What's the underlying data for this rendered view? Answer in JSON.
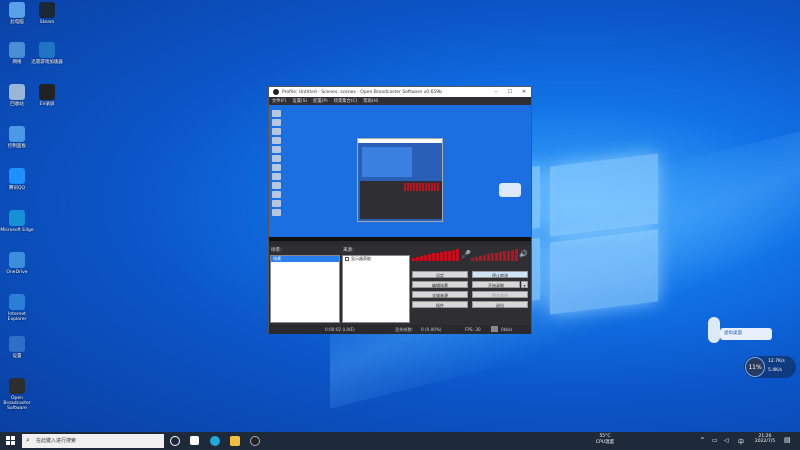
{
  "desktop_icons": [
    {
      "label": "此电脑",
      "color": "#5aa0e8"
    },
    {
      "label": "Steam",
      "color": "#1b2838"
    },
    {
      "label": "网络",
      "color": "#4a8fd6"
    },
    {
      "label": "迅雷游戏加速器",
      "color": "#1f74c4"
    },
    {
      "label": "回收站",
      "color": "#9ab6d6"
    },
    {
      "label": "EV录屏",
      "color": "#222222"
    },
    {
      "label": "控制面板",
      "color": "#4a9ae8"
    },
    {
      "label": "腾讯QQ",
      "color": "#1e90ff"
    },
    {
      "label": "Microsoft Edge",
      "color": "#1790d6"
    },
    {
      "label": "OneDrive",
      "color": "#3a8edc"
    },
    {
      "label": "Internet Explorer",
      "color": "#2a7fd6"
    },
    {
      "label": "设置",
      "color": "#2f6fc8"
    },
    {
      "label": "Open Broadcaster Software",
      "color": "#2e2e2e"
    }
  ],
  "obs": {
    "title": "Profile: Untitled - Scenes: scenes - Open Broadcaster Software v0.659b",
    "menu": [
      "文件(F)",
      "设置(S)",
      "配置(P)",
      "场景集合(C)",
      "帮助(H)"
    ],
    "scenes_label": "场景：",
    "sources_label": "来源：",
    "scene_item": "场景",
    "source_item": "显示器获取",
    "buttons": {
      "settings": "设定",
      "stop_stream": "停止串流",
      "edit_scene": "编辑场景",
      "start_record": "开始录制",
      "global_sources": "全域来源",
      "preview_stream": "预览串流",
      "plugins": "插件",
      "exit": "退出"
    },
    "status": {
      "time": "0:00:02 (LIVE)",
      "dropped": "丢失帧数:",
      "dropped_val": "0 (0.00%)",
      "fps": "FPS: 30",
      "kbps": "0kb/s"
    }
  },
  "taskbar": {
    "search_placeholder": "在此键入进行搜索",
    "weather_temp": "55°C",
    "weather_label": "CPU温度",
    "time": "21:26",
    "date": "2022/7/5"
  },
  "net_widget": {
    "load": "11%",
    "up": "12.7K/s",
    "down": "5.4K/s"
  },
  "floating_widget": {
    "label": "虚拟桌面"
  }
}
